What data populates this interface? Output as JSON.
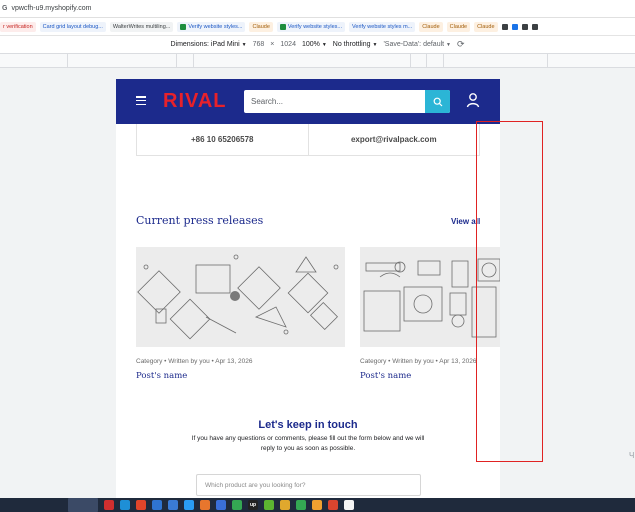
{
  "browser": {
    "address": "vpwcfh-u9.myshopify.com",
    "bookmarks": [
      {
        "label": "r verification",
        "style": "red"
      },
      {
        "label": "Card grid layout debug...",
        "style": "blue"
      },
      {
        "label": "WalterWrites multiling...",
        "style": "grey"
      },
      {
        "label": "Verify website styles...",
        "style": "check"
      },
      {
        "label": "Claude",
        "style": "orange"
      },
      {
        "label": "Verify website styles...",
        "style": "check"
      },
      {
        "label": "Verify website styles m...",
        "style": "blue"
      },
      {
        "label": "Claude",
        "style": "orange"
      },
      {
        "label": "Claude",
        "style": "orange"
      },
      {
        "label": "Claude",
        "style": "orange"
      },
      {
        "label": "Claude",
        "style": "orange"
      }
    ],
    "device_toolbar": {
      "dimensions_label": "Dimensions: iPad Mini",
      "width": "768",
      "times": "×",
      "height": "1024",
      "zoom": "100%",
      "throttling": "No throttling",
      "save_data": "'Save-Data': default"
    },
    "side_char": "Ч"
  },
  "site": {
    "logo": "RIVAL",
    "search_placeholder": "Search...",
    "contact": {
      "phone": "+86 10 65206578",
      "email": "export@rivalpack.com"
    },
    "press": {
      "title": "Current press releases",
      "view_all": "View all",
      "posts": [
        {
          "category": "Category",
          "author": "Written by you",
          "date": "Apr 13, 2026",
          "name": "Post's name"
        },
        {
          "category": "Category",
          "author": "Written by you",
          "date": "Apr 13, 2026",
          "name": "Post's name"
        }
      ]
    },
    "touch": {
      "title": "Let's keep in touch",
      "text": "If you have any questions or comments, please fill out the form below and we will reply to you as soon as possible.",
      "field_placeholder": "Which product are you looking for?"
    }
  },
  "colors": {
    "header": "#1c2a8c",
    "logo": "#e8212a",
    "search_button": "#2bb5d6",
    "annotation": "#e02222"
  },
  "icons": [
    "hamburger-icon",
    "search-icon",
    "user-icon",
    "rotate-icon"
  ]
}
